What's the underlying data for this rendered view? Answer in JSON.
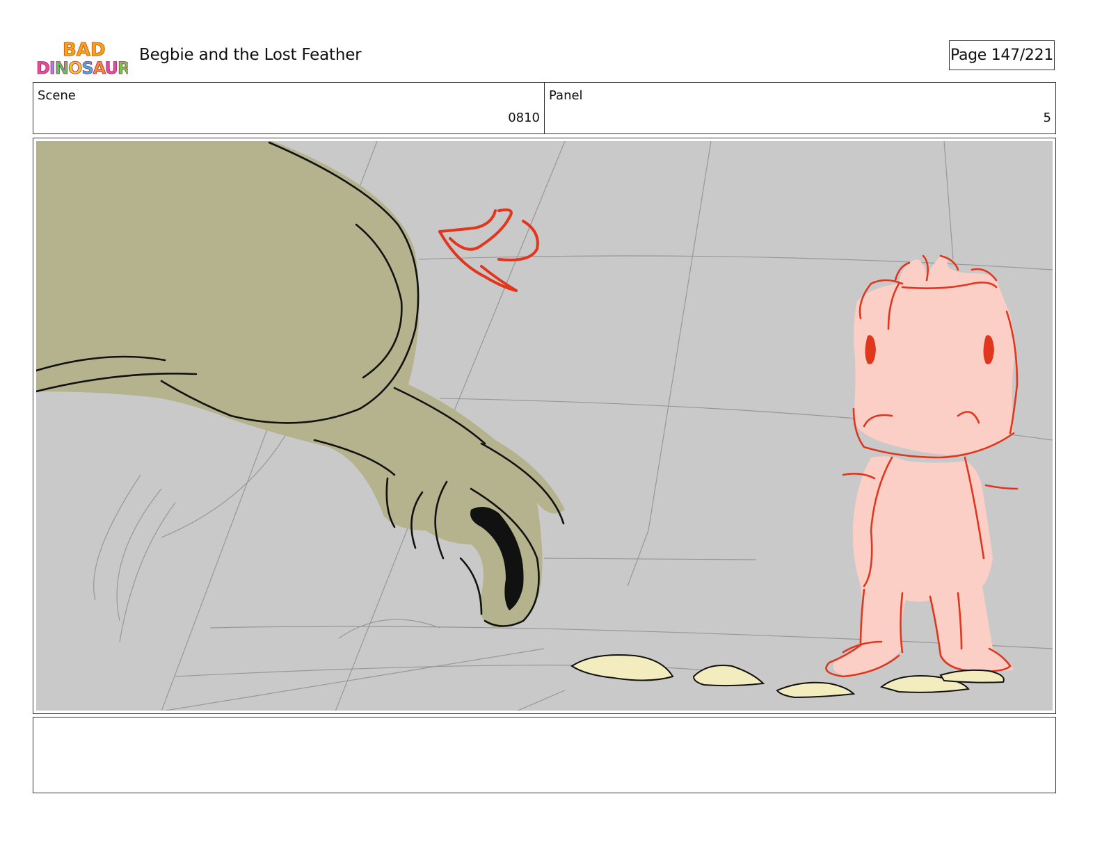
{
  "header": {
    "logo_text": "BAD DINOSAURS",
    "title": "Begbie and the Lost Feather",
    "page": "Page 147/221"
  },
  "info": {
    "scene_label": "Scene",
    "scene_value": "0810",
    "panel_label": "Panel",
    "panel_value": "5"
  },
  "notes": {
    "text": ""
  },
  "colors": {
    "background_gray": "#c9c9c9",
    "dino_olive": "#b5b28e",
    "character_pink": "#fccfc6",
    "character_outline": "#e0361d",
    "arrow_red": "#e3341c",
    "feathers_yellow": "#f3ecbe"
  }
}
